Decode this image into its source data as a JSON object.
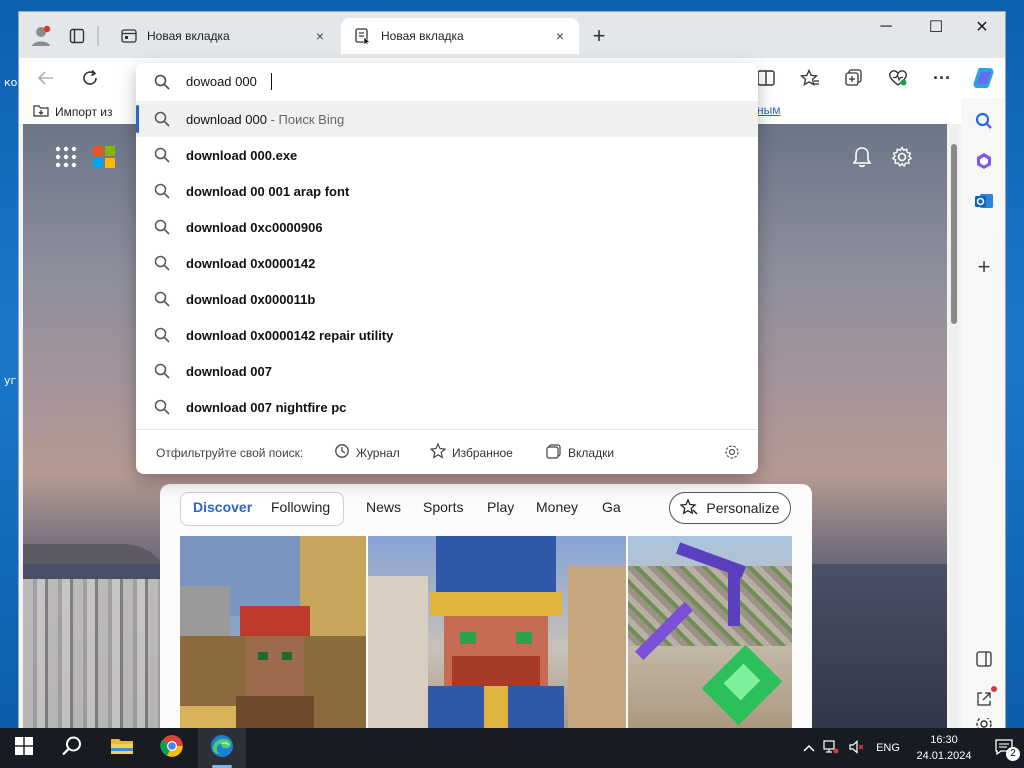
{
  "desktop": {
    "label_1": "ко",
    "label_2": "уг"
  },
  "browser": {
    "tabs": [
      {
        "title": "Новая вкладка",
        "active": false
      },
      {
        "title": "Новая вкладка",
        "active": true
      }
    ],
    "add_tab": "+",
    "close_tab": "×",
    "window": {
      "minimize": "─",
      "maximize": "☐",
      "close": "✕"
    }
  },
  "address": {
    "value": "dowoad 000",
    "placeholder": ""
  },
  "suggestions": [
    {
      "bold": "",
      "text": "download 000",
      "suffix": " - Поиск Bing",
      "selected": true
    },
    {
      "bold": "download ",
      "text": "000",
      "suffix": ".exe",
      "selected": false
    },
    {
      "bold": "download ",
      "text": "00 001 arap font",
      "suffix": "",
      "selected": false
    },
    {
      "bold": "download ",
      "text": "0xc0000906",
      "suffix": "",
      "selected": false
    },
    {
      "bold": "download ",
      "text": "0x0000142",
      "suffix": "",
      "selected": false
    },
    {
      "bold": "download ",
      "text": "0x000011b",
      "suffix": "",
      "selected": false
    },
    {
      "bold": "download ",
      "text": "0x0000142 repair utility",
      "suffix": "",
      "selected": false
    },
    {
      "bold": "download ",
      "text": "007",
      "suffix": "",
      "selected": false
    },
    {
      "bold": "download ",
      "text": "007 nightfire pc",
      "suffix": "",
      "selected": false
    }
  ],
  "filter": {
    "label": "Отфильтруйте свой поиск:",
    "history": "Журнал",
    "favorites": "Избранное",
    "tabs": "Вкладки"
  },
  "favbar": {
    "import": "Импорт из",
    "other": "ранным"
  },
  "feed": {
    "discover": "Discover",
    "following": "Following",
    "news": "News",
    "sports": "Sports",
    "play": "Play",
    "money": "Money",
    "ga": "Ga",
    "personalize": "Personalize"
  },
  "taskbar": {
    "lang": "ENG",
    "time": "16:30",
    "date": "24.01.2024",
    "notifications": "2"
  },
  "colors": {
    "accent": "#2a66c6",
    "taskbar": "#181b22",
    "copilot": "#2aa3e6"
  }
}
